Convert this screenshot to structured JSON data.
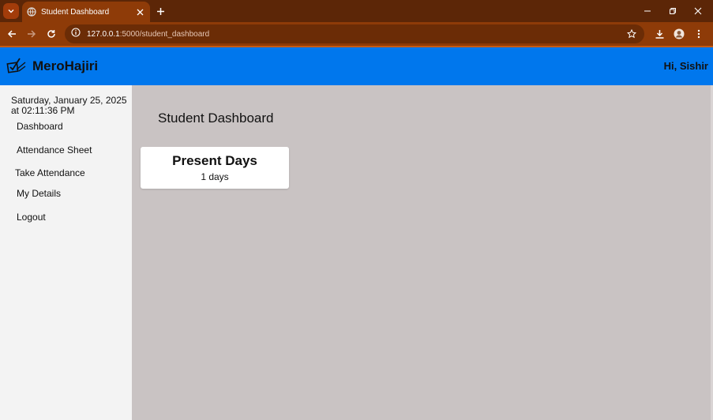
{
  "browser": {
    "tab_title": "Student Dashboard",
    "url_host": "127.0.0.1",
    "url_path": ":5000/student_dashboard"
  },
  "app": {
    "brand": "MeroHajiri",
    "greeting": "Hi, Sishir",
    "header_color": "#0077ed"
  },
  "sidebar": {
    "date_line1": "Saturday, January 25, 2025",
    "date_line2": "at 02:11:36 PM",
    "items": [
      {
        "label": "Dashboard"
      },
      {
        "label": "Attendance Sheet"
      },
      {
        "label": "Take Attendance"
      },
      {
        "label": "My Details"
      },
      {
        "label": "Logout"
      }
    ]
  },
  "main": {
    "title": "Student Dashboard",
    "card": {
      "title": "Present Days",
      "value": "1 days"
    }
  }
}
